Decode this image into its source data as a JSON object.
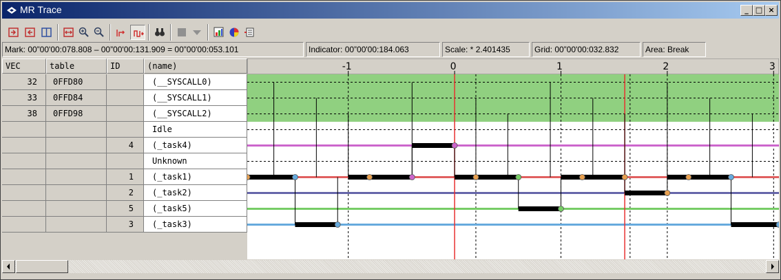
{
  "window": {
    "title": "MR Trace"
  },
  "status": {
    "mark": "Mark: 00”00'00:078.808 – 00”00'00:131.909 = 00”00'00:053.101",
    "indicator": "Indicator: 00”00'00:184.063",
    "scale": "Scale: * 2.401435",
    "grid": "Grid: 00”00'00:032.832",
    "area": "Area: Break"
  },
  "table": {
    "headers": {
      "vec": "VEC",
      "table": "table",
      "id": "ID",
      "name": "(name)"
    },
    "rows": [
      {
        "vec": "32",
        "table": "0FFD80",
        "id": "",
        "name": "(__SYSCALL0)"
      },
      {
        "vec": "33",
        "table": "0FFD84",
        "id": "",
        "name": "(__SYSCALL1)"
      },
      {
        "vec": "38",
        "table": "0FFD98",
        "id": "",
        "name": "(__SYSCALL2)"
      },
      {
        "vec": "",
        "table": "",
        "id": "",
        "name": "Idle"
      },
      {
        "vec": "",
        "table": "",
        "id": "4",
        "name": "(_task4)"
      },
      {
        "vec": "",
        "table": "",
        "id": "",
        "name": "Unknown"
      },
      {
        "vec": "",
        "table": "",
        "id": "1",
        "name": "(_task1)"
      },
      {
        "vec": "",
        "table": "",
        "id": "2",
        "name": "(_task2)"
      },
      {
        "vec": "",
        "table": "",
        "id": "5",
        "name": "(_task5)"
      },
      {
        "vec": "",
        "table": "",
        "id": "3",
        "name": "(_task3)"
      }
    ]
  },
  "timeline": {
    "ticks": [
      "-1",
      "0",
      "1",
      "2",
      "3"
    ],
    "tick_values": [
      -1,
      0,
      1,
      2,
      3
    ],
    "x_range": [
      -1.95,
      3.05
    ],
    "red_markers": [
      0,
      1.6
    ],
    "dashed_marks": [
      -1,
      0.2,
      1,
      1.65,
      2,
      3
    ],
    "colors": {
      "syscall_bg": "#90d080",
      "task4": "#cc66cc",
      "task1": "#e06060",
      "task2": "#6666aa",
      "task5": "#77cc66",
      "task3": "#66aadd",
      "red_marker": "#e83030"
    },
    "syscall_calls": [
      -1.7,
      -1.3,
      -1.0,
      -0.4,
      0.2,
      0.5,
      0.9,
      1.3,
      1.6,
      2.0,
      2.4,
      2.8
    ]
  },
  "icons": [
    "mark-start-icon",
    "mark-end-icon",
    "mark-range-icon",
    "fit-icon",
    "zoom-in-icon",
    "zoom-out-icon",
    "trace-step-icon",
    "trace-jump-icon",
    "find-icon",
    "stop-icon",
    "dropdown-icon",
    "chart-icon",
    "pie-icon",
    "list-icon"
  ]
}
